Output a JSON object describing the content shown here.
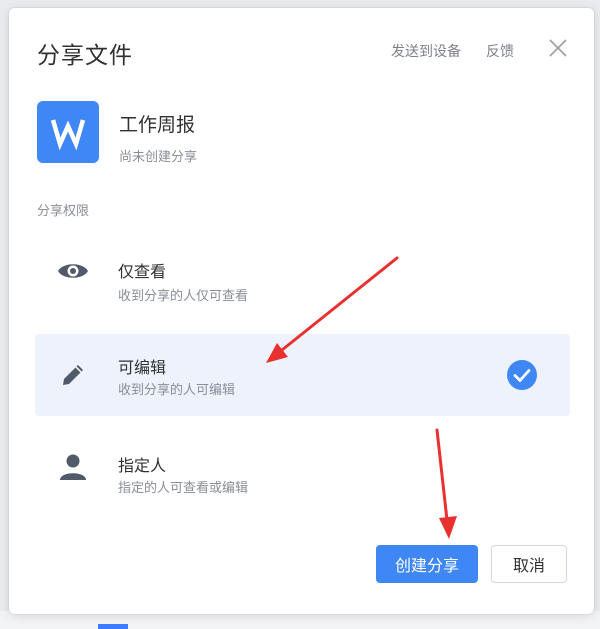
{
  "dialog": {
    "title": "分享文件",
    "send_to_device": "发送到设备",
    "feedback": "反馈",
    "close_icon": "close-icon"
  },
  "file": {
    "icon_letter": "W",
    "icon_color": "#3f87f5",
    "name": "工作周报",
    "status": "尚未创建分享"
  },
  "permissions": {
    "label": "分享权限",
    "options": [
      {
        "title": "仅查看",
        "desc": "收到分享的人仅可查看",
        "icon": "eye-icon",
        "selected": false
      },
      {
        "title": "可编辑",
        "desc": "收到分享的人可编辑",
        "icon": "pencil-icon",
        "selected": true
      },
      {
        "title": "指定人",
        "desc": "指定的人可查看或编辑",
        "icon": "person-icon",
        "selected": false
      }
    ]
  },
  "buttons": {
    "create": "创建分享",
    "cancel": "取消"
  },
  "colors": {
    "primary": "#3f87f5",
    "selected_bg": "#edf2fd",
    "annotation_arrow": "#e8312f"
  }
}
